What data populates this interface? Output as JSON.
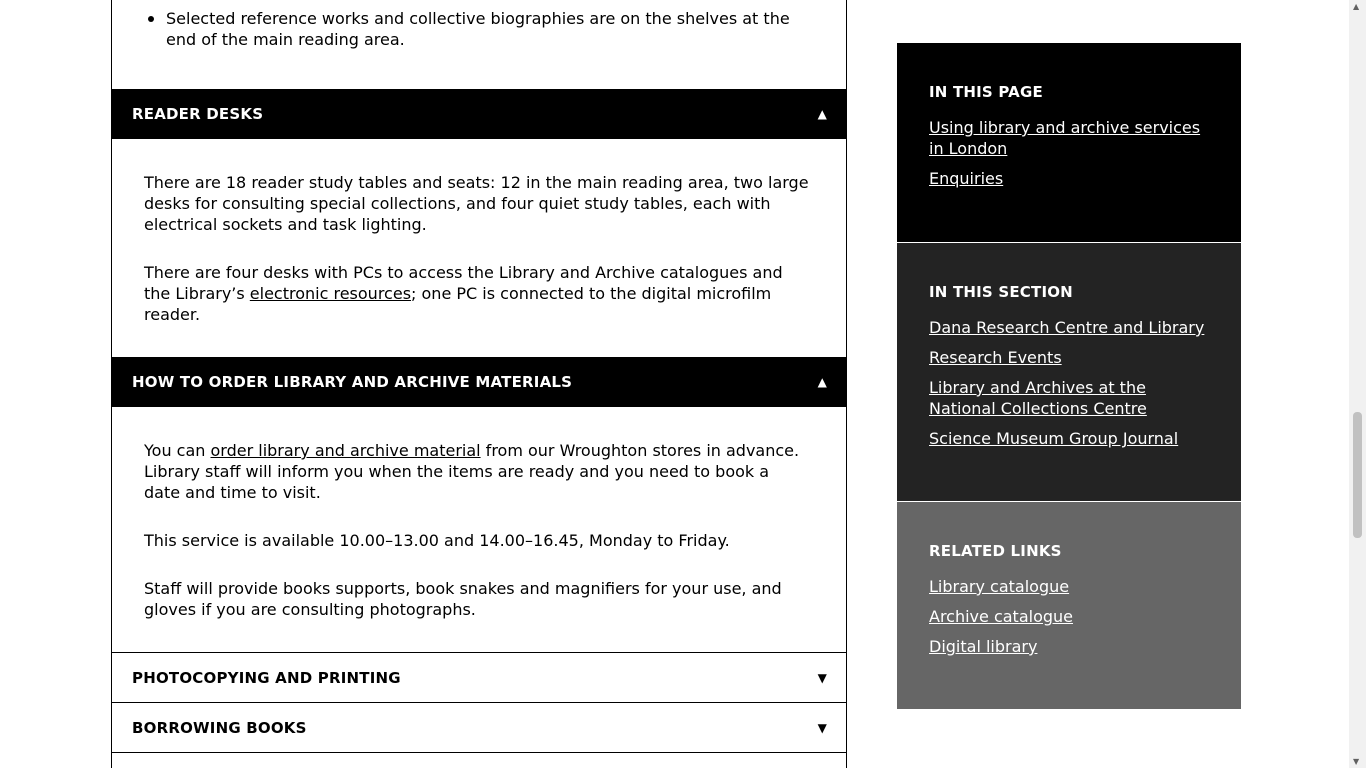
{
  "intro": {
    "bullet": "Selected reference works and collective biographies are on the shelves at the end of the main reading area."
  },
  "accordion": {
    "reader_desks": {
      "title": "READER DESKS",
      "p1": "There are 18 reader study tables and seats: 12 in the main reading area, two large desks for consulting special collections, and four quiet study tables, each with electrical sockets and task lighting.",
      "p2_before": "There are four desks with PCs to access the Library and Archive catalogues and the Library’s ",
      "p2_link": "electronic resources",
      "p2_after": "; one PC is connected to the digital microfilm reader."
    },
    "how_to_order": {
      "title": "HOW TO ORDER LIBRARY AND ARCHIVE MATERIALS",
      "p1_before": "You can ",
      "p1_link": "order library and archive material",
      "p1_after": " from our Wroughton stores in advance. Library staff will inform you when the items are ready and you need to book a date and time to visit.",
      "p2": "This service is available 10.00–13.00 and 14.00–16.45, Monday to Friday.",
      "p3": "Staff will provide books supports, book snakes and magnifiers for your use, and gloves if you are consulting photographs."
    },
    "photocopying": {
      "title": "PHOTOCOPYING AND PRINTING"
    },
    "borrowing": {
      "title": "BORROWING BOOKS"
    },
    "open_glyph": "▲",
    "closed_glyph": "▼"
  },
  "sidebar": {
    "in_this_page": {
      "heading": "IN THIS PAGE",
      "links": [
        "Using library and archive services in London",
        "Enquiries"
      ]
    },
    "in_this_section": {
      "heading": "IN THIS SECTION",
      "links": [
        "Dana Research Centre and Library",
        "Research Events",
        "Library and Archives at the National Collections Centre",
        "Science Museum Group Journal"
      ]
    },
    "related_links": {
      "heading": "RELATED LINKS",
      "links": [
        "Library catalogue",
        "Archive catalogue",
        "Digital library"
      ]
    }
  }
}
